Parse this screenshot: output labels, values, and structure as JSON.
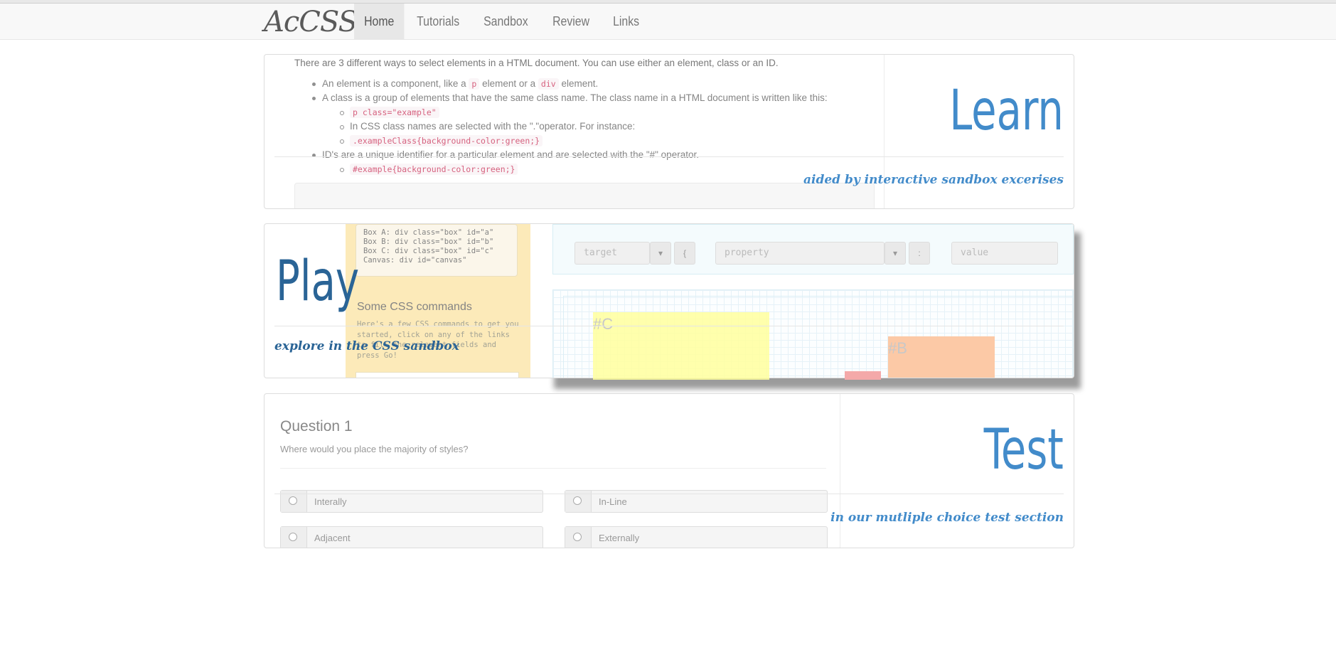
{
  "nav": {
    "brand": "AcCSS",
    "items": [
      {
        "label": "Home",
        "active": true
      },
      {
        "label": "Tutorials",
        "active": false
      },
      {
        "label": "Sandbox",
        "active": false
      },
      {
        "label": "Review",
        "active": false
      },
      {
        "label": "Links",
        "active": false
      }
    ]
  },
  "learn": {
    "heading": "Learn",
    "tagline": "aided by interactive sandbox excerises",
    "intro": "There are 3 different ways to select elements in a HTML document. You can use either an element, class or an ID.",
    "b1_pre": "An element is a component, like a",
    "b1_code1": "p",
    "b1_mid": "element or a",
    "b1_code2": "div",
    "b1_post": "element.",
    "b2": "A class is a group of elements that have the same class name. The class name in a HTML document is written like this:",
    "s1_code": "p class=\"example\"",
    "s2": "In CSS class names are selected with the \".\"operator. For instance:",
    "s3_code": ".exampleClass{background-color:green;}",
    "b3": "ID's are a unique identifier for a particular element and are selected with the \"#\" operator.",
    "s4_code": "#example{background-color:green;}"
  },
  "play": {
    "heading": "Play",
    "tagline": "explore in the CSS sandbox",
    "code_lines": [
      "Box A: div class=\"box\" id=\"a\"",
      "Box B: div class=\"box\" id=\"b\"",
      "Box C: div class=\"box\" id=\"c\"",
      "Canvas: div id=\"canvas\""
    ],
    "commands_title": "Some CSS commands",
    "commands_text": "Here's a few CSS commands to get you started, click on any of the links to fill the relevant fields and press Go!",
    "target_placeholder": "target",
    "brace": "{",
    "property_placeholder": "property",
    "colon": ":",
    "value_placeholder": "value",
    "box_c_label": "#C",
    "box_b_label": "#B"
  },
  "test": {
    "heading": "Test",
    "tagline": "in our mutliple choice test section",
    "question_title": "Question 1",
    "question_text": "Where would you place the majority of styles?",
    "answers": [
      "Interally",
      "In-Line",
      "Adjacent",
      "Externally"
    ]
  },
  "colors": {
    "accent": "#428bca",
    "accent_dark": "#2a6496",
    "box_c": "#ffff9e",
    "box_b": "#fcc9a6",
    "box_a": "#f4a9a9"
  }
}
